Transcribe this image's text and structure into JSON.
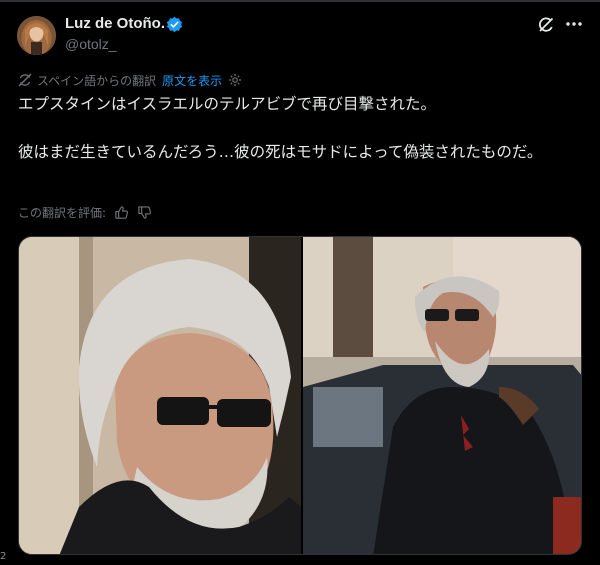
{
  "post": {
    "author_name": "Luz de Otoño.",
    "author_handle": "@otolz_",
    "translation_note": "スペイン語からの翻訳",
    "show_original": "原文を表示",
    "text": "エプスタインはイスラエルのテルアビブで再び目撃された。\n\n彼はまだ生きているんだろう…彼の死はモサドによって偽装されたものだ。",
    "rate_translation": "この翻訳を評価:",
    "icons": {
      "verified": "verified-badge-icon",
      "grok": "grok-icon",
      "more": "more-icon",
      "translate": "translate-icon",
      "settings": "gear-icon",
      "like": "thumbs-up-icon",
      "dislike": "thumbs-down-icon"
    }
  },
  "edge_label": "2",
  "colors": {
    "accent": "#1d9bf0",
    "muted": "#71767b",
    "text": "#e7e9ea",
    "bg": "#000000"
  }
}
